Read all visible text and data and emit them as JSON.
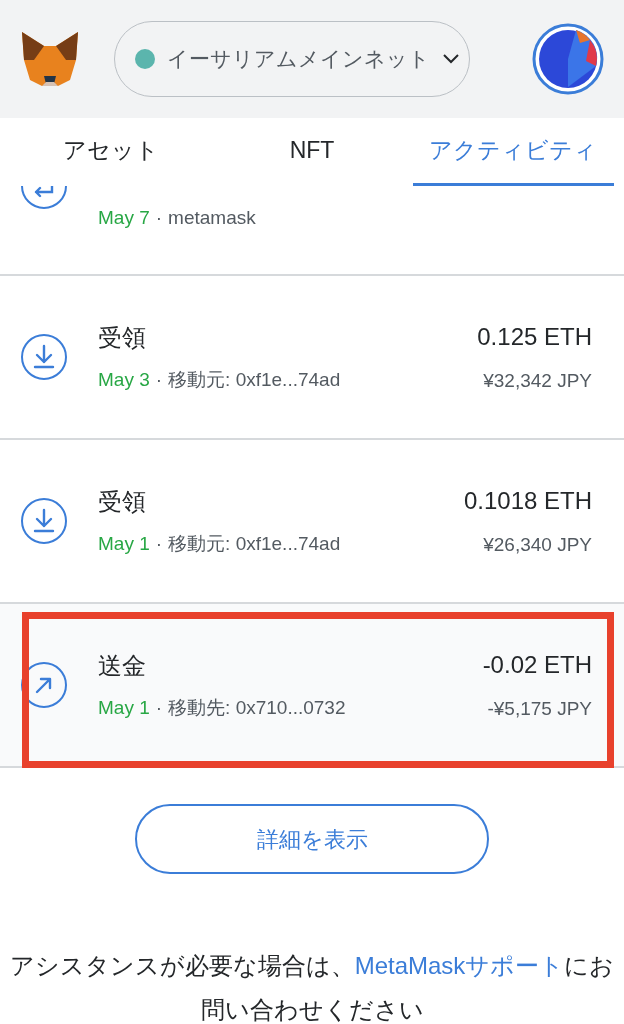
{
  "header": {
    "network": {
      "label": "イーサリアムメインネット"
    }
  },
  "tabs": [
    {
      "label": "アセット",
      "selected": false
    },
    {
      "label": "NFT",
      "selected": false
    },
    {
      "label": "アクティビティ",
      "selected": true
    }
  ],
  "transactions": [
    {
      "kind": "partial",
      "date": "May 7",
      "separator": "·",
      "detail": "metamask"
    },
    {
      "kind": "receive",
      "title": "受領",
      "date": "May 3",
      "separator": "·",
      "detail": "移動元: 0xf1e...74ad",
      "amount": "0.125 ETH",
      "fiat": "¥32,342 JPY",
      "highlighted": false
    },
    {
      "kind": "receive",
      "title": "受領",
      "date": "May 1",
      "separator": "·",
      "detail": "移動元: 0xf1e...74ad",
      "amount": "0.1018 ETH",
      "fiat": "¥26,340 JPY",
      "highlighted": false
    },
    {
      "kind": "send",
      "title": "送金",
      "date": "May 1",
      "separator": "·",
      "detail": "移動先: 0x710...0732",
      "amount": "-0.02 ETH",
      "fiat": "-¥5,175 JPY",
      "highlighted": true
    }
  ],
  "view_more_button": "詳細を表示",
  "help": {
    "text": "アシスタンスが必要な場合は、",
    "link": "MetaMaskサポート",
    "text_after": "にお問い合わせください"
  }
}
